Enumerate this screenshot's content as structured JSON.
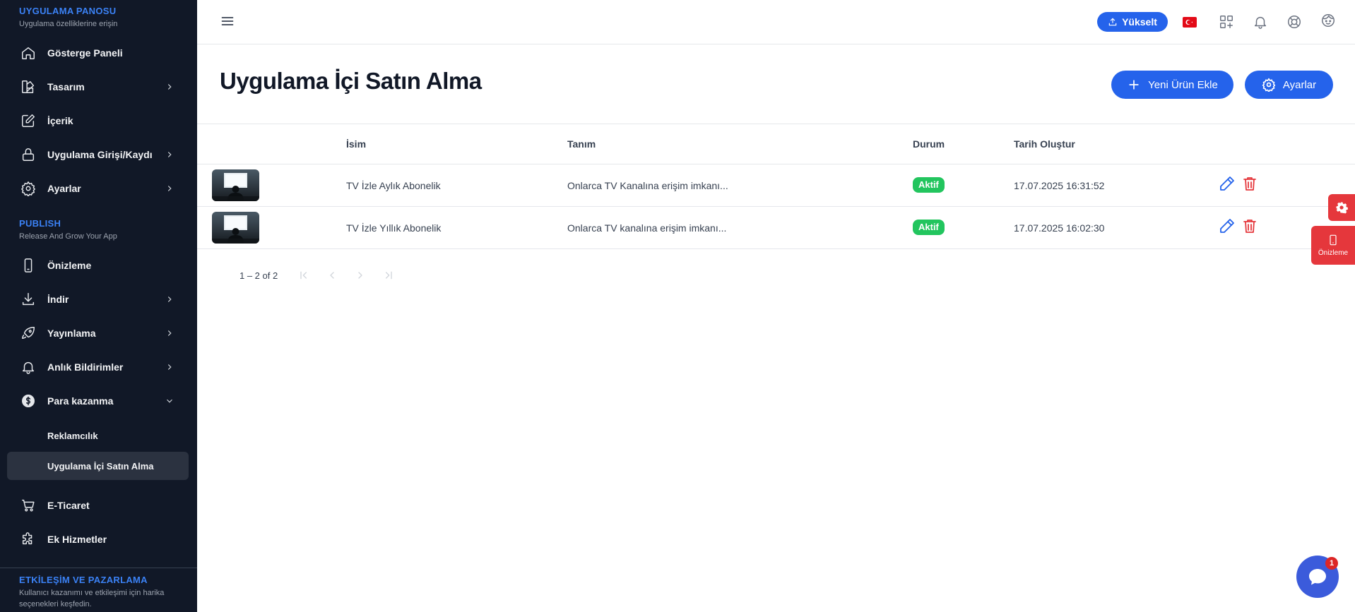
{
  "sidebar": {
    "section1": {
      "title": "UYGULAMA PANOSU",
      "subtitle": "Uygulama özelliklerine erişin"
    },
    "items1": [
      {
        "label": "Gösterge Paneli",
        "icon": "home-icon"
      },
      {
        "label": "Tasarım",
        "icon": "design-icon"
      },
      {
        "label": "İçerik",
        "icon": "edit-icon"
      },
      {
        "label": "Uygulama Girişi/Kaydı",
        "icon": "lock-icon"
      },
      {
        "label": "Ayarlar",
        "icon": "gear-icon"
      }
    ],
    "section2": {
      "title": "PUBLISH",
      "subtitle": "Release And Grow Your App"
    },
    "items2": [
      {
        "label": "Önizleme",
        "icon": "phone-icon"
      },
      {
        "label": "İndir",
        "icon": "download-icon"
      },
      {
        "label": "Yayınlama",
        "icon": "rocket-icon"
      },
      {
        "label": "Anlık Bildirimler",
        "icon": "bell-icon"
      },
      {
        "label": "Para kazanma",
        "icon": "dollar-icon"
      }
    ],
    "sub_items": [
      {
        "label": "Reklamcılık"
      },
      {
        "label": "Uygulama İçi Satın Alma"
      }
    ],
    "items3": [
      {
        "label": "E-Ticaret",
        "icon": "cart-icon"
      },
      {
        "label": "Ek Hizmetler",
        "icon": "puzzle-icon"
      }
    ],
    "section3": {
      "title": "ETKİLEŞİM VE PAZARLAMA",
      "subtitle": "Kullanıcı kazanımı ve etkileşimi için harika seçenekleri keşfedin."
    }
  },
  "topbar": {
    "upgrade_label": "Yükselt",
    "icons": [
      "grid-plus-icon",
      "bell-icon",
      "lifebuoy-icon",
      "face-icon"
    ],
    "flag_color": "#e30a17"
  },
  "page": {
    "title": "Uygulama İçi Satın Alma",
    "add_button": "Yeni Ürün Ekle",
    "settings_button": "Ayarlar"
  },
  "table": {
    "headers": {
      "name": "İsim",
      "description": "Tanım",
      "status": "Durum",
      "created": "Tarih Oluştur"
    },
    "rows": [
      {
        "name": "TV İzle Aylık Abonelik",
        "description": "Onlarca TV Kanalına erişim imkanı...",
        "status": "Aktif",
        "created": "17.07.2025 16:31:52"
      },
      {
        "name": "TV İzle Yıllık Abonelik",
        "description": "Onlarca TV kanalına erişim imkanı...",
        "status": "Aktif",
        "created": "17.07.2025 16:02:30"
      }
    ]
  },
  "pagination": {
    "label": "1 – 2 of 2"
  },
  "floating": {
    "preview_label": "Önizleme",
    "chat_badge": "1"
  },
  "colors": {
    "accent": "#2563eb",
    "sidebar_bg": "#111827",
    "success": "#22c55e",
    "danger": "#e5373c"
  }
}
